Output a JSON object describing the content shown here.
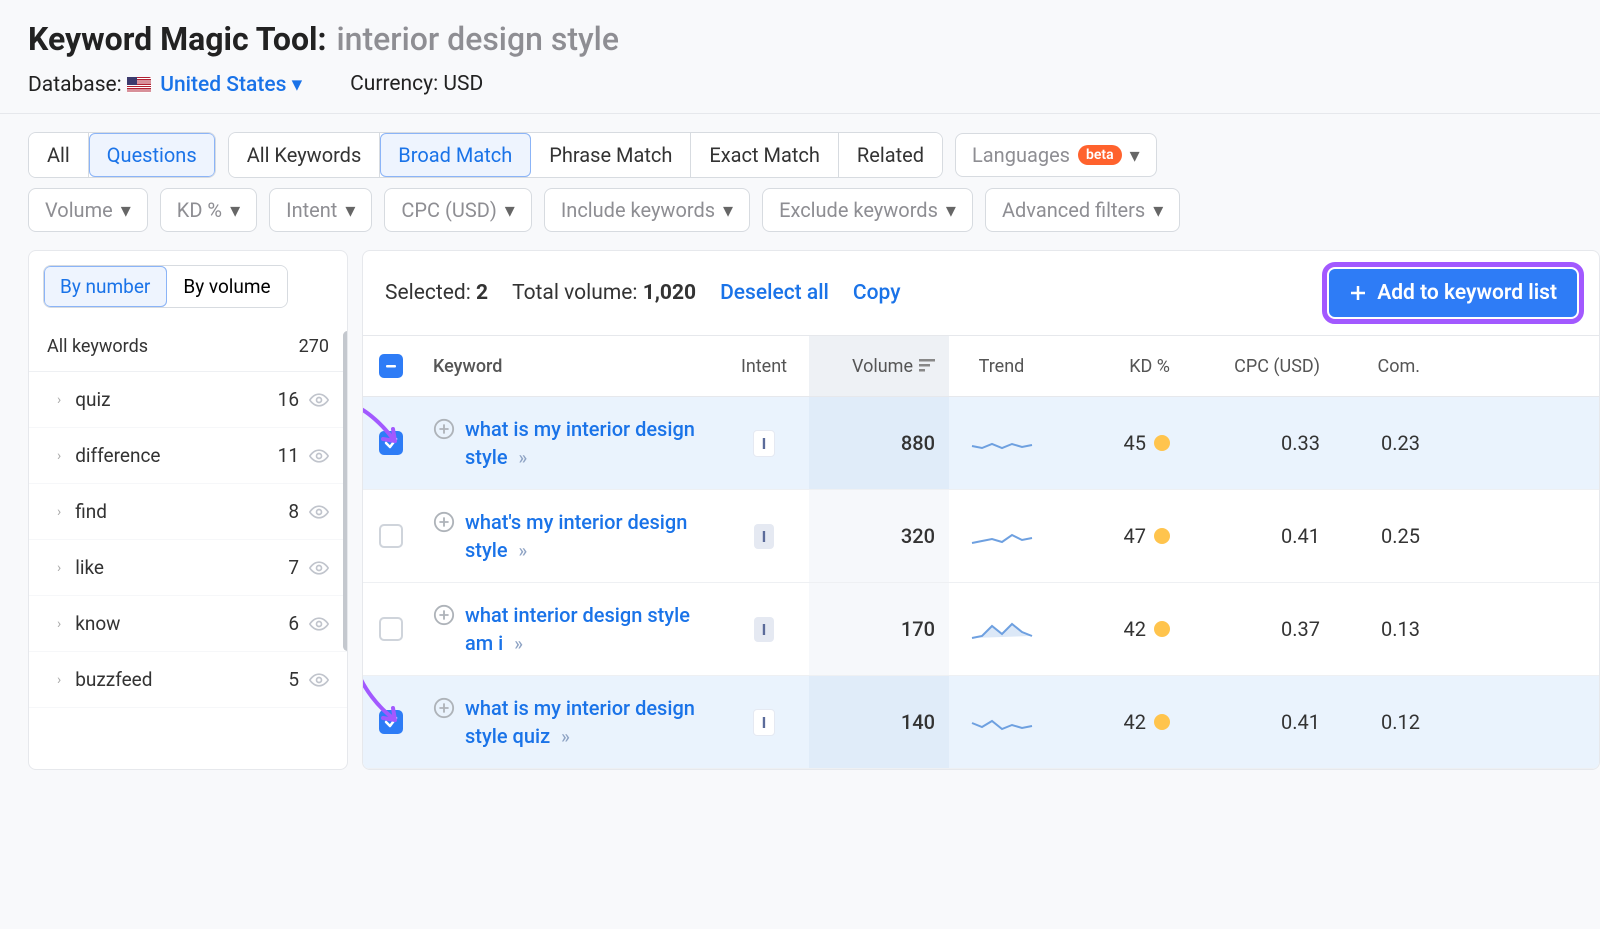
{
  "header": {
    "tool_name": "Keyword Magic Tool:",
    "query": "interior design style",
    "db_label": "Database:",
    "db_country": "United States",
    "currency_label": "Currency:",
    "currency_value": "USD"
  },
  "top_tabs": {
    "all": "All",
    "questions": "Questions",
    "all_keywords": "All Keywords",
    "broad": "Broad Match",
    "phrase": "Phrase Match",
    "exact": "Exact Match",
    "related": "Related",
    "languages": "Languages",
    "beta": "beta"
  },
  "filters": {
    "volume": "Volume",
    "kd": "KD %",
    "intent": "Intent",
    "cpc": "CPC (USD)",
    "include": "Include keywords",
    "exclude": "Exclude keywords",
    "advanced": "Advanced filters"
  },
  "sidebar": {
    "by_number": "By number",
    "by_volume": "By volume",
    "all_kw_label": "All keywords",
    "all_kw_count": "270",
    "items": [
      {
        "label": "quiz",
        "count": "16"
      },
      {
        "label": "difference",
        "count": "11"
      },
      {
        "label": "find",
        "count": "8"
      },
      {
        "label": "like",
        "count": "7"
      },
      {
        "label": "know",
        "count": "6"
      },
      {
        "label": "buzzfeed",
        "count": "5"
      }
    ]
  },
  "summary": {
    "selected_label": "Selected:",
    "selected_count": "2",
    "total_label": "Total volume:",
    "total_value": "1,020",
    "deselect": "Deselect all",
    "copy": "Copy",
    "add": "Add to keyword list"
  },
  "columns": {
    "keyword": "Keyword",
    "intent": "Intent",
    "volume": "Volume",
    "trend": "Trend",
    "kd": "KD %",
    "cpc": "CPC (USD)",
    "com": "Com."
  },
  "rows": [
    {
      "selected": true,
      "keyword": "what is my interior design style",
      "intent": "I",
      "intent_white": true,
      "volume": "880",
      "kd": "45",
      "kd_color": "yellow",
      "cpc": "0.33",
      "com": "0.23"
    },
    {
      "selected": false,
      "keyword": "what's my interior design style",
      "intent": "I",
      "intent_white": false,
      "volume": "320",
      "kd": "47",
      "kd_color": "yellow",
      "cpc": "0.41",
      "com": "0.25"
    },
    {
      "selected": false,
      "keyword": "what interior design style am i",
      "intent": "I",
      "intent_white": false,
      "volume": "170",
      "kd": "42",
      "kd_color": "yellow",
      "cpc": "0.37",
      "com": "0.13"
    },
    {
      "selected": true,
      "keyword": "what is my interior design style quiz",
      "intent": "I",
      "intent_white": true,
      "volume": "140",
      "kd": "42",
      "kd_color": "yellow",
      "cpc": "0.41",
      "com": "0.12"
    }
  ]
}
